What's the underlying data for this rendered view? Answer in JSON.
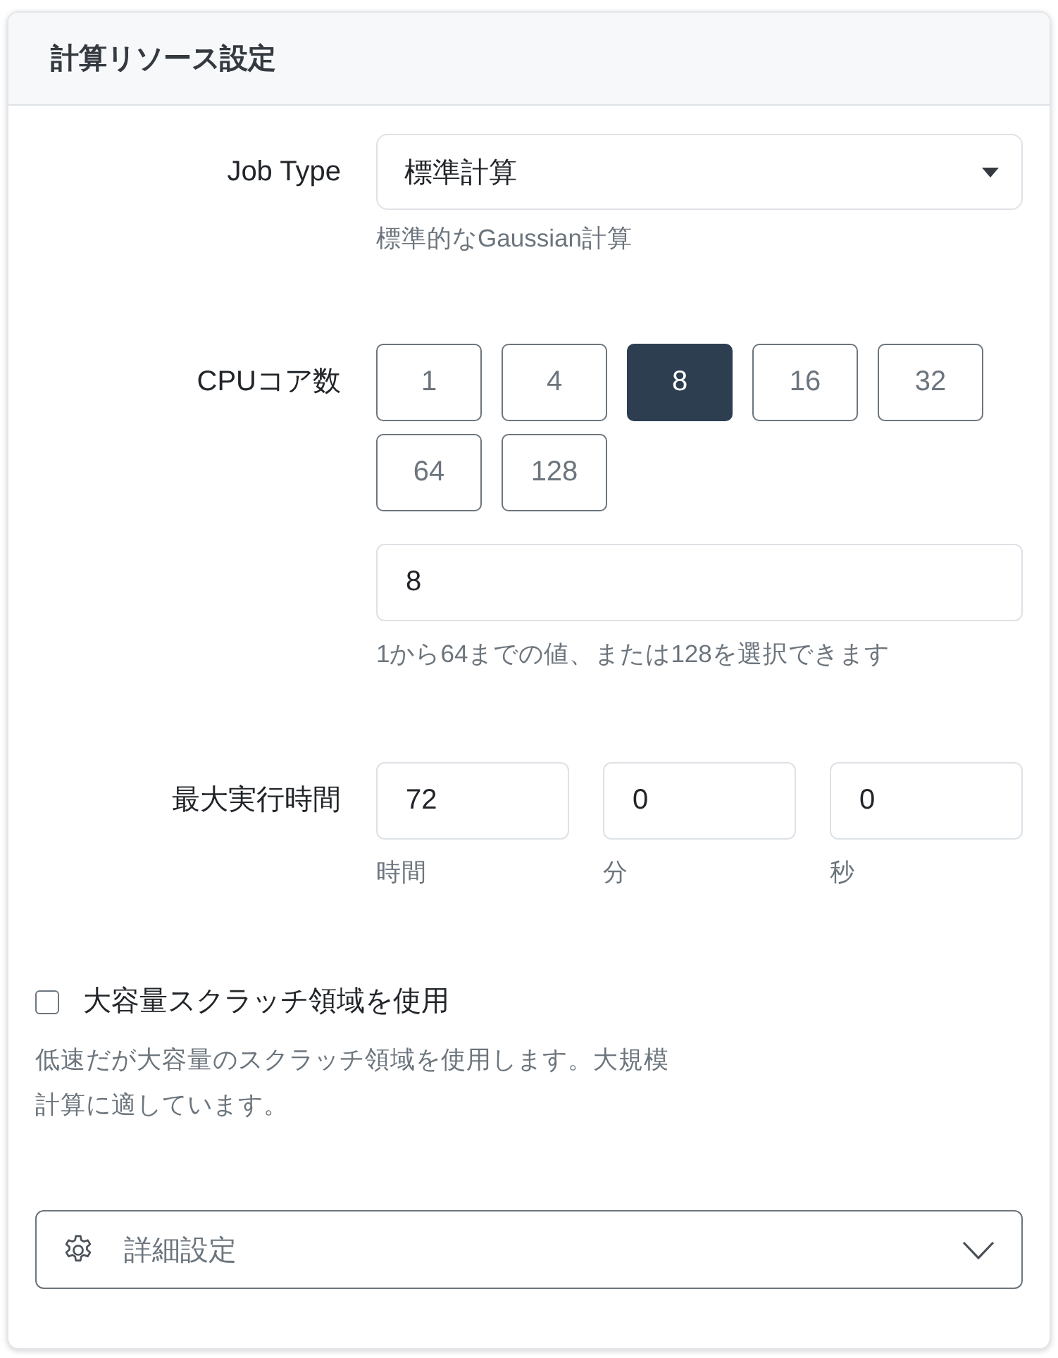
{
  "panel": {
    "title": "計算リソース設定"
  },
  "job_type": {
    "label": "Job Type",
    "value": "標準計算",
    "help": "標準的なGaussian計算"
  },
  "cpu_cores": {
    "label": "CPUコア数",
    "options": [
      {
        "label": "1",
        "selected": false
      },
      {
        "label": "4",
        "selected": false
      },
      {
        "label": "8",
        "selected": true
      },
      {
        "label": "16",
        "selected": false
      },
      {
        "label": "32",
        "selected": false
      },
      {
        "label": "64",
        "selected": false
      },
      {
        "label": "128",
        "selected": false
      }
    ],
    "value": "8",
    "help": "1から64までの値、または128を選択できます"
  },
  "max_runtime": {
    "label": "最大実行時間",
    "fields": [
      {
        "value": "72",
        "unit": "時間"
      },
      {
        "value": "0",
        "unit": "分"
      },
      {
        "value": "0",
        "unit": "秒"
      }
    ]
  },
  "scratch": {
    "label": "大容量スクラッチ領域を使用",
    "checked": false,
    "description": "低速だが大容量のスクラッチ領域を使用します。大規模計算に適しています。"
  },
  "advanced": {
    "label": "詳細設定",
    "expanded": false
  }
}
